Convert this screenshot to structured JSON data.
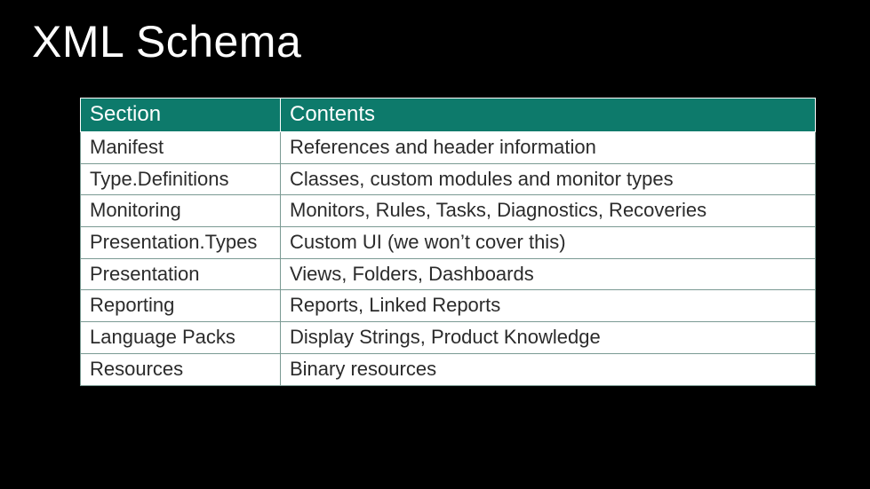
{
  "title": "XML Schema",
  "table": {
    "headers": {
      "section": "Section",
      "contents": "Contents"
    },
    "rows": [
      {
        "section": "Manifest",
        "contents": "References and header information"
      },
      {
        "section": "Type.Definitions",
        "contents": "Classes, custom modules and monitor types"
      },
      {
        "section": "Monitoring",
        "contents": "Monitors, Rules, Tasks, Diagnostics, Recoveries"
      },
      {
        "section": "Presentation.Types",
        "contents": "Custom UI (we won’t cover this)"
      },
      {
        "section": "Presentation",
        "contents": "Views, Folders, Dashboards"
      },
      {
        "section": "Reporting",
        "contents": "Reports, Linked Reports"
      },
      {
        "section": "Language Packs",
        "contents": "Display Strings, Product Knowledge"
      },
      {
        "section": "Resources",
        "contents": "Binary resources"
      }
    ]
  }
}
